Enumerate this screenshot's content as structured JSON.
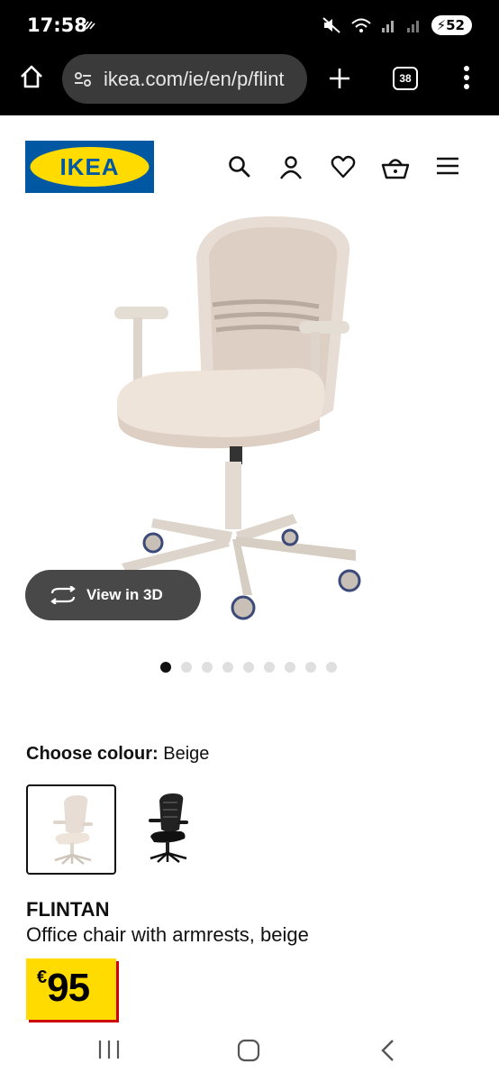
{
  "status_bar": {
    "time": "17:58",
    "battery": "52"
  },
  "browser": {
    "url": "ikea.com/ie/en/p/flint",
    "tab_count": "38"
  },
  "header": {
    "logo_text": "IKEA",
    "icons": [
      "search-icon",
      "account-icon",
      "heart-icon",
      "basket-icon",
      "menu-icon"
    ]
  },
  "gallery": {
    "view_3d_label": "View in 3D",
    "image_count": 9,
    "active_index": 0
  },
  "colour": {
    "label": "Choose colour:",
    "selected": "Beige",
    "options": [
      "beige",
      "black"
    ]
  },
  "product": {
    "name": "FLINTAN",
    "description": "Office chair with armrests, beige",
    "currency": "€",
    "price": "95"
  },
  "colors": {
    "ikea_blue": "#0058a3",
    "ikea_yellow": "#ffdb00",
    "price_shadow": "#cc0008",
    "chair_beige": "#e6d9cf"
  }
}
